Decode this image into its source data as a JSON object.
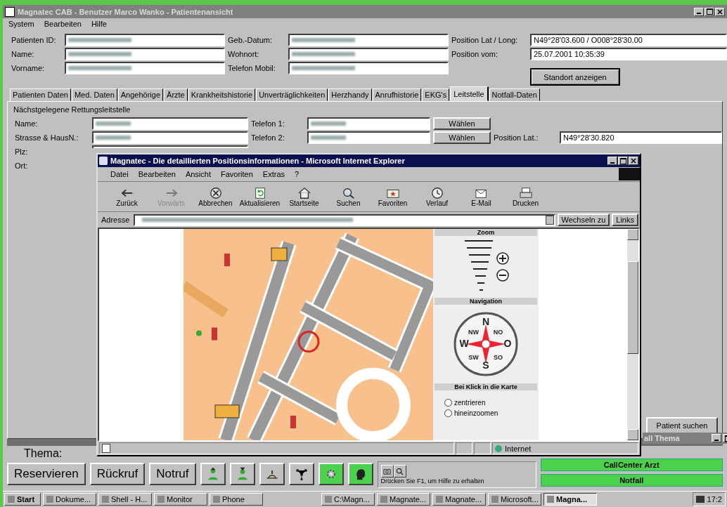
{
  "window": {
    "title": "Magnatec CAB - Benutzer Marco Wanko - Patientenansicht"
  },
  "menu": [
    "System",
    "Bearbeiten",
    "Hilfe"
  ],
  "patient_fields": [
    {
      "label": "Patienten ID:",
      "blurred": true
    },
    {
      "label": "Geb.-Datum:",
      "blurred": true
    },
    {
      "label": "Position Lat / Long:",
      "value": "N49°28'03.600 / O008°28'30.00",
      "blurred": false
    },
    {
      "label": "Name:",
      "blurred": true
    },
    {
      "label": "Wohnort:",
      "blurred": true
    },
    {
      "label": "Position vom:",
      "value": "25.07.2001 10:35:39",
      "blurred": false
    },
    {
      "label": "Vorname:",
      "blurred": true
    },
    {
      "label": "Telefon Mobil:",
      "blurred": true
    }
  ],
  "standort_button": "Standort anzeigen",
  "tabs": [
    {
      "label": "Patienten Daten",
      "selected": false
    },
    {
      "label": "Med. Daten",
      "selected": false
    },
    {
      "label": "Angehörige",
      "selected": false
    },
    {
      "label": "Ärzte",
      "selected": false
    },
    {
      "label": "Krankheitshistorie",
      "selected": false
    },
    {
      "label": "Unverträglichkeiten",
      "selected": false
    },
    {
      "label": "Herzhandy",
      "selected": false
    },
    {
      "label": "Anrufhistorie",
      "selected": false
    },
    {
      "label": "EKG's",
      "selected": false
    },
    {
      "label": "Leitstelle",
      "selected": true
    },
    {
      "label": "Notfall-Daten",
      "selected": false
    }
  ],
  "leitstelle": {
    "group_title": "Nächstgelegene Rettungsleitstelle",
    "fields": [
      {
        "label": "Name:",
        "kind": "full"
      },
      {
        "label": "Strasse & HausN.:",
        "kind": "full"
      },
      {
        "label": "Plz:",
        "kind": "partial"
      },
      {
        "label": "Ort:",
        "kind": "hidden"
      }
    ],
    "phones": [
      {
        "label": "Telefon 1:",
        "blurred": true,
        "button": "Wählen"
      },
      {
        "label": "Telefon 2:",
        "blurred": true,
        "button": "Wählen"
      }
    ],
    "position_lat": {
      "label": "Position Lat.:",
      "value": "N49°28'30.820"
    },
    "search_button": "Patient suchen"
  },
  "browser": {
    "title": "Magnatec - Die detaillierten Positionsinformationen - Microsoft Internet Explorer",
    "menu": [
      "Datei",
      "Bearbeiten",
      "Ansicht",
      "Favoriten",
      "Extras",
      "?"
    ],
    "toolbar": [
      {
        "label": "Zurück",
        "kind": "back",
        "disabled": false
      },
      {
        "label": "Vorwärts",
        "kind": "forward",
        "disabled": true
      },
      {
        "label": "Abbrechen",
        "kind": "stop",
        "disabled": false
      },
      {
        "label": "Aktualisieren",
        "kind": "refresh",
        "disabled": false
      },
      {
        "label": "Startseite",
        "kind": "home",
        "disabled": false
      },
      {
        "label": "Suchen",
        "kind": "search",
        "disabled": false
      },
      {
        "label": "Favoriten",
        "kind": "favorites",
        "disabled": false
      },
      {
        "label": "Verlauf",
        "kind": "history",
        "disabled": false
      },
      {
        "label": "E-Mail",
        "kind": "mail",
        "disabled": false
      },
      {
        "label": "Drucken",
        "kind": "print",
        "disabled": false
      }
    ],
    "address_label": "Adresse",
    "go_button": "Wechseln zu",
    "links": "Links",
    "panel": {
      "zoom_title": "Zoom",
      "navigation_title": "Navigation",
      "compass": [
        "N",
        "NO",
        "O",
        "SO",
        "S",
        "SW",
        "W",
        "NW"
      ],
      "click_title": "Bei Klick in die Karte",
      "options": [
        {
          "label": "zentrieren",
          "selected": false
        },
        {
          "label": "hineinzoomen",
          "selected": false
        }
      ]
    },
    "status": "Internet"
  },
  "mini_window": {
    "title": "all Thema"
  },
  "thema": {
    "label": "Thema:",
    "buttons": [
      "Reservieren",
      "Rückruf",
      "Notruf"
    ],
    "icon_buttons": [
      {
        "kind": "person-up",
        "on": false
      },
      {
        "kind": "person-down",
        "on": false
      },
      {
        "kind": "hill",
        "on": false
      },
      {
        "kind": "network",
        "on": false
      },
      {
        "kind": "gear",
        "on": true
      },
      {
        "kind": "head",
        "on": true
      }
    ],
    "help": "Drücken Sie F1, um Hilfe zu erhalten",
    "status_buttons": [
      "CallCenter Arzt",
      "Notfall"
    ]
  },
  "taskbar": {
    "items": [
      {
        "label": "Start",
        "selected": false
      },
      {
        "label": "Dokume...",
        "selected": false
      },
      {
        "label": "Shell - H...",
        "selected": false
      },
      {
        "label": "Monitor",
        "selected": false
      },
      {
        "label": "Phone",
        "selected": false
      },
      {
        "label": "C:\\Magn...",
        "selected": false
      },
      {
        "label": "Magnate...",
        "selected": false
      },
      {
        "label": "Magnate...",
        "selected": false
      },
      {
        "label": "Microsoft...",
        "selected": false
      },
      {
        "label": "Magna...",
        "selected": true
      }
    ],
    "clock": "17:2"
  }
}
